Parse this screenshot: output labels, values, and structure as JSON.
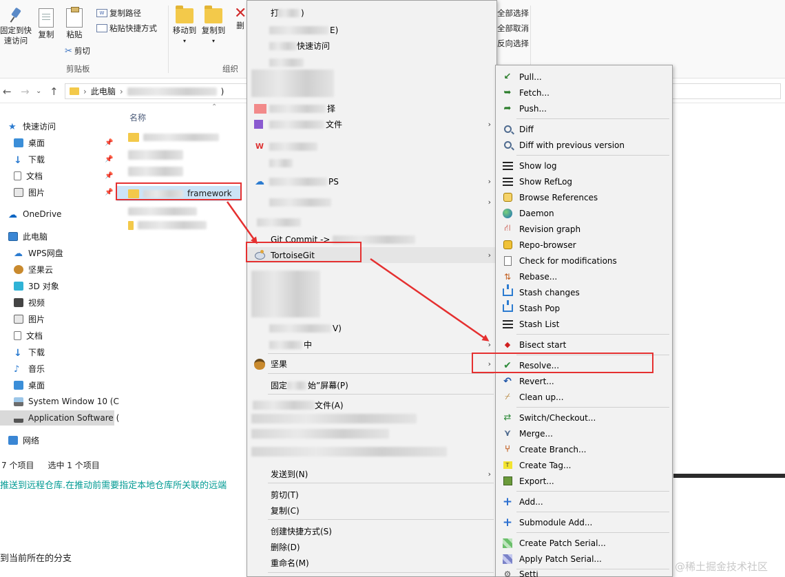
{
  "ribbon": {
    "pin_label_1": "固定到快",
    "pin_label_2": "速访问",
    "copy_label": "复制",
    "paste_label": "粘贴",
    "copy_path_label": "复制路径",
    "paste_shortcut_label": "粘贴快捷方式",
    "cut_label": "剪切",
    "clipboard_group": "剪贴板",
    "move_to_label": "移动到",
    "copy_to_label": "复制到",
    "delete_label_partial": "删",
    "organize_group": "组织",
    "select_all": "全部选择",
    "select_none": "全部取消",
    "invert_select": "反向选择"
  },
  "address": {
    "crumb_root": "此电脑",
    "crumb_tail": ")"
  },
  "navpane": {
    "quick_access": "快速访问",
    "quick_items": [
      "桌面",
      "下载",
      "文档",
      "图片"
    ],
    "onedrive": "OneDrive",
    "this_pc": "此电脑",
    "pc_items": [
      "WPS网盘",
      "坚果云",
      "3D 对象",
      "视频",
      "图片",
      "文档",
      "下载",
      "音乐",
      "桌面",
      "System Window 10 (C",
      "Application Software ("
    ],
    "network": "网络"
  },
  "filelist": {
    "column_name": "名称",
    "selected_folder": "framework"
  },
  "statusbar": {
    "item_count": "7 个项目",
    "selected": "选中 1 个项目"
  },
  "article": {
    "line1": "推送到远程仓库.在推动前需要指定本地仓库所关联的远端",
    "line2": "到当前所在的分支"
  },
  "context_menu": {
    "item_open": "打",
    "item_open_tail": ")",
    "item_tail_e": "E)",
    "item_quick_access_tail": "快速访问",
    "item_select_tail": "择",
    "item_file_tail": "文件",
    "item_wps": "PS",
    "item_git_commit": "Git Commit ->",
    "item_tortoisegit": "TortoiseGit",
    "item_tail_v": "V)",
    "item_tail_zhong": "中",
    "item_jianguo": "坚果",
    "item_pin_start_prefix": "固定",
    "item_pin_start_suffix": "始”屏幕(P)",
    "item_file_a": "文件(A)",
    "item_send_to": "发送到(N)",
    "item_cut": "剪切(T)",
    "item_copy": "复制(C)",
    "item_create_shortcut": "创建快捷方式(S)",
    "item_delete": "删除(D)",
    "item_rename": "重命名(M)"
  },
  "tortoise_menu": {
    "items": {
      "pull": "Pull...",
      "fetch": "Fetch...",
      "push": "Push...",
      "diff": "Diff",
      "diff_prev": "Diff with previous version",
      "show_log": "Show log",
      "show_reflog": "Show RefLog",
      "browse_refs": "Browse References",
      "daemon": "Daemon",
      "revision_graph": "Revision graph",
      "repo_browser": "Repo-browser",
      "check_mods": "Check for modifications",
      "rebase": "Rebase...",
      "stash_changes": "Stash changes",
      "stash_pop": "Stash Pop",
      "stash_list": "Stash List",
      "bisect_start": "Bisect start",
      "resolve": "Resolve...",
      "revert": "Revert...",
      "clean_up": "Clean up...",
      "switch_checkout": "Switch/Checkout...",
      "merge": "Merge...",
      "create_branch": "Create Branch...",
      "create_tag": "Create Tag...",
      "export": "Export...",
      "add": "Add...",
      "submodule_add": "Submodule Add...",
      "create_patch": "Create Patch Serial...",
      "apply_patch": "Apply Patch Serial...",
      "settings_partial": "Setti"
    }
  },
  "watermark": "@稀土掘金技术社区",
  "colors": {
    "annotation_red": "#e53030",
    "selection_blue": "#cce4f7",
    "menu_bg": "#f2f2f2",
    "article_teal": "#009a93"
  }
}
